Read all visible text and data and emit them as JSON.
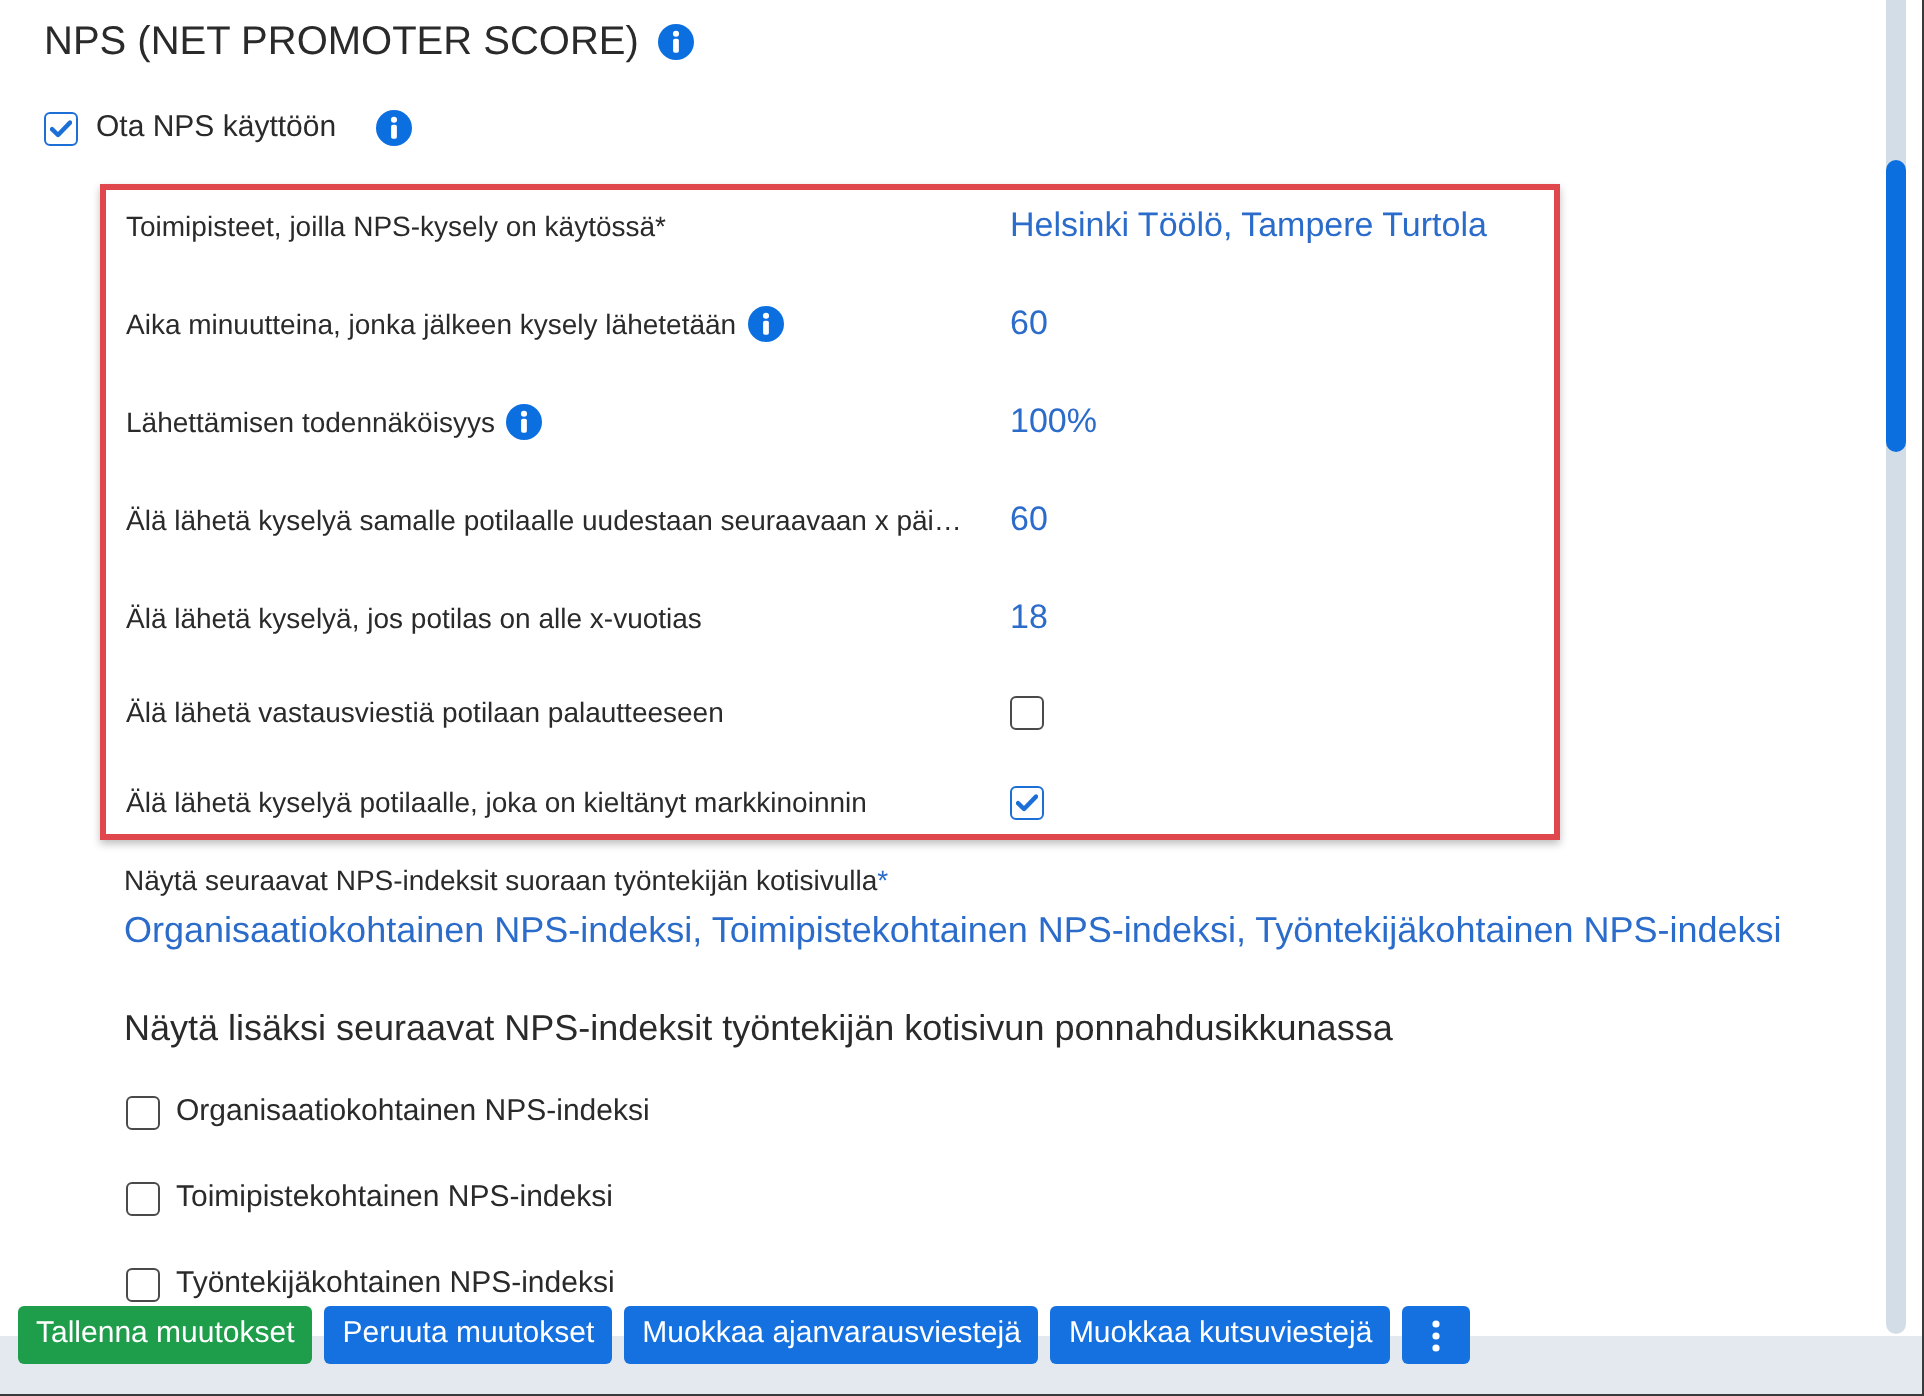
{
  "section": {
    "title": "NPS (NET PROMOTER SCORE)",
    "info": true
  },
  "enable": {
    "label": "Ota NPS käyttöön",
    "checked": true,
    "info": true
  },
  "settings": [
    {
      "kind": "value",
      "label": "Toimipisteet, joilla NPS-kysely on käytössä*",
      "info": false,
      "value": "Helsinki Töölö, Tampere Turtola"
    },
    {
      "kind": "value",
      "label": "Aika minuutteina, jonka jälkeen kysely lähetetään",
      "info": true,
      "value": "60"
    },
    {
      "kind": "value",
      "label": "Lähettämisen todennäköisyys",
      "info": true,
      "value": "100%"
    },
    {
      "kind": "value",
      "label": "Älä lähetä kyselyä samalle potilaalle uudestaan seuraavaan x päi…",
      "info": false,
      "value": "60"
    },
    {
      "kind": "value",
      "label": "Älä lähetä kyselyä, jos potilas on alle x-vuotias",
      "info": false,
      "value": "18"
    },
    {
      "kind": "checkbox",
      "label": "Älä lähetä vastausviestiä potilaan palautteeseen",
      "info": false,
      "checked": false
    },
    {
      "kind": "checkbox",
      "label": "Älä lähetä kyselyä potilaalle, joka on kieltänyt markkinoinnin",
      "info": false,
      "checked": true
    }
  ],
  "home_indices": {
    "label": "Näytä seuraavat NPS-indeksit suoraan työntekijän kotisivulla",
    "required_mark": "*",
    "value": "Organisaatiokohtainen NPS-indeksi, Toimipistekohtainen NPS-indeksi, Työntekijäkohtainen NPS-indeksi"
  },
  "popup_indices": {
    "heading": "Näytä lisäksi seuraavat NPS-indeksit työntekijän kotisivun ponnahdusikkunassa",
    "options": [
      {
        "label": "Organisaatiokohtainen NPS-indeksi",
        "checked": false
      },
      {
        "label": "Toimipistekohtainen NPS-indeksi",
        "checked": false
      },
      {
        "label": "Työntekijäkohtainen NPS-indeksi",
        "checked": false
      }
    ]
  },
  "buttons": [
    {
      "kind": "success",
      "label": "Tallenna muutokset"
    },
    {
      "kind": "primary",
      "label": "Peruuta muutokset"
    },
    {
      "kind": "primary",
      "label": "Muokkaa ajanvarausviestejä"
    },
    {
      "kind": "primary",
      "label": "Muokkaa kutsuviestejä"
    },
    {
      "kind": "menu"
    }
  ]
}
